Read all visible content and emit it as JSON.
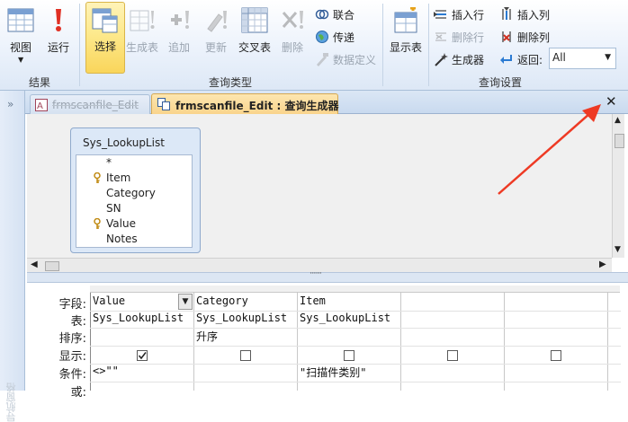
{
  "ribbon": {
    "results_group": {
      "label": "结果",
      "buttons": [
        {
          "label": "视图",
          "icon": "datasheet-view-icon"
        },
        {
          "label": "运行",
          "icon": "run-exclamation-icon"
        }
      ]
    },
    "query_type_group": {
      "label": "查询类型",
      "buttons": [
        {
          "label": "选择",
          "icon": "select-query-icon",
          "state": "selected"
        },
        {
          "label": "生成表",
          "icon": "make-table-icon",
          "state": "disabled"
        },
        {
          "label": "追加",
          "icon": "append-icon",
          "state": "disabled"
        },
        {
          "label": "更新",
          "icon": "update-icon",
          "state": "disabled"
        },
        {
          "label": "交叉表",
          "icon": "crosstab-icon",
          "state": "enabled"
        },
        {
          "label": "删除",
          "icon": "delete-icon",
          "state": "disabled"
        }
      ],
      "small_buttons": [
        {
          "label": "联合",
          "icon": "union-icon",
          "state": "enabled"
        },
        {
          "label": "传递",
          "icon": "pass-through-globe-icon",
          "state": "enabled"
        },
        {
          "label": "数据定义",
          "icon": "data-definition-icon",
          "state": "disabled"
        }
      ]
    },
    "query_setup_group": {
      "label": "查询设置",
      "show_table": {
        "label": "显示表",
        "icon": "show-table-icon"
      },
      "small_buttons": [
        {
          "label": "插入行",
          "icon": "insert-row-icon",
          "state": "enabled"
        },
        {
          "label": "删除行",
          "icon": "delete-row-icon",
          "state": "disabled"
        },
        {
          "label": "生成器",
          "icon": "builder-wand-icon",
          "state": "enabled"
        },
        {
          "label": "插入列",
          "icon": "insert-column-icon",
          "state": "enabled"
        },
        {
          "label": "删除列",
          "icon": "delete-column-icon",
          "state": "enabled"
        }
      ],
      "return_label": "返回:",
      "return_value": "All"
    }
  },
  "tabs": [
    {
      "label": "frmscanfile_Edit",
      "active": false,
      "icon": "form-icon"
    },
    {
      "label": "frmscanfile_Edit : 查询生成器",
      "active": true,
      "icon": "query-icon"
    }
  ],
  "close_symbol": "✕",
  "nav_pane": {
    "label": "导航窗格",
    "toggle": "»"
  },
  "table": {
    "title": "Sys_LookupList",
    "fields": [
      {
        "name": "*",
        "key": false
      },
      {
        "name": "Item",
        "key": true
      },
      {
        "name": "Category",
        "key": false
      },
      {
        "name": "SN",
        "key": false
      },
      {
        "name": "Value",
        "key": true
      },
      {
        "name": "Notes",
        "key": false
      }
    ]
  },
  "grid": {
    "row_labels": [
      "字段:",
      "表:",
      "排序:",
      "显示:",
      "条件:",
      "或:"
    ],
    "columns": [
      {
        "field": "Value",
        "table": "Sys_LookupList",
        "sort": "",
        "show": true,
        "criteria": "<>\"\"",
        "has_dropdown": true
      },
      {
        "field": "Category",
        "table": "Sys_LookupList",
        "sort": "升序",
        "show": false,
        "criteria": ""
      },
      {
        "field": "Item",
        "table": "Sys_LookupList",
        "sort": "",
        "show": false,
        "criteria": "\"扫描件类别\""
      },
      {
        "field": "",
        "table": "",
        "sort": "",
        "show": false,
        "criteria": ""
      },
      {
        "field": "",
        "table": "",
        "sort": "",
        "show": false,
        "criteria": ""
      }
    ]
  },
  "colors": {
    "selected_button": "#fde98c",
    "annotation_arrow": "#ee3a24",
    "active_tab": "#f9d38a"
  }
}
